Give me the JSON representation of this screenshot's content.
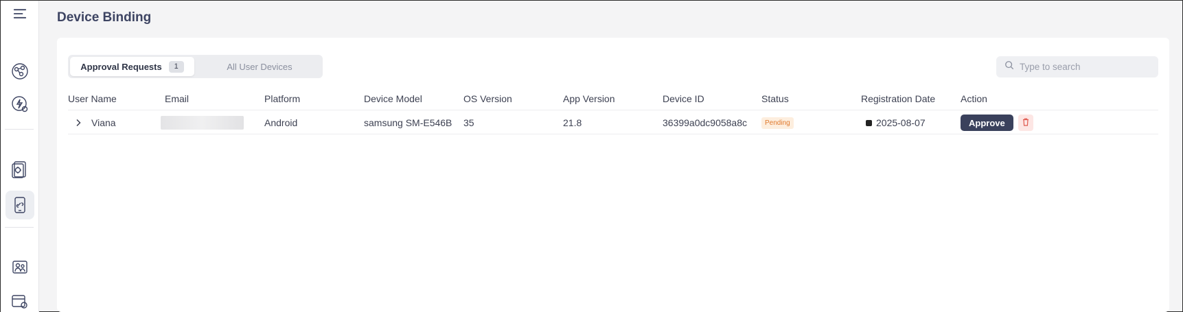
{
  "page": {
    "title": "Device Binding"
  },
  "sidebar": {
    "icons": [
      "menu-icon",
      "network-icon",
      "energy-icon",
      "document-gear-icon",
      "device-link-icon",
      "user-group-icon",
      "calendar-location-icon"
    ]
  },
  "tabs": [
    {
      "label": "Approval Requests",
      "count": "1",
      "active": true
    },
    {
      "label": "All User Devices",
      "active": false
    }
  ],
  "search": {
    "placeholder": "Type to search",
    "value": ""
  },
  "table": {
    "columns": [
      "User Name",
      "Email",
      "Platform",
      "Device Model",
      "OS Version",
      "App Version",
      "Device ID",
      "Status",
      "Registration Date",
      "Action"
    ],
    "rows": [
      {
        "user_name": "Viana",
        "email": "",
        "platform": "Android",
        "device_model": "samsung SM-E546B",
        "os_version": "35",
        "app_version": "21.8",
        "device_id": "36399a0dc9058a8c",
        "status": "Pending",
        "registration_date": "2025-08-07",
        "approve_label": "Approve"
      }
    ]
  },
  "colors": {
    "primary": "#3a415c",
    "pending": "#e07a2e",
    "danger": "#e05a4f"
  }
}
